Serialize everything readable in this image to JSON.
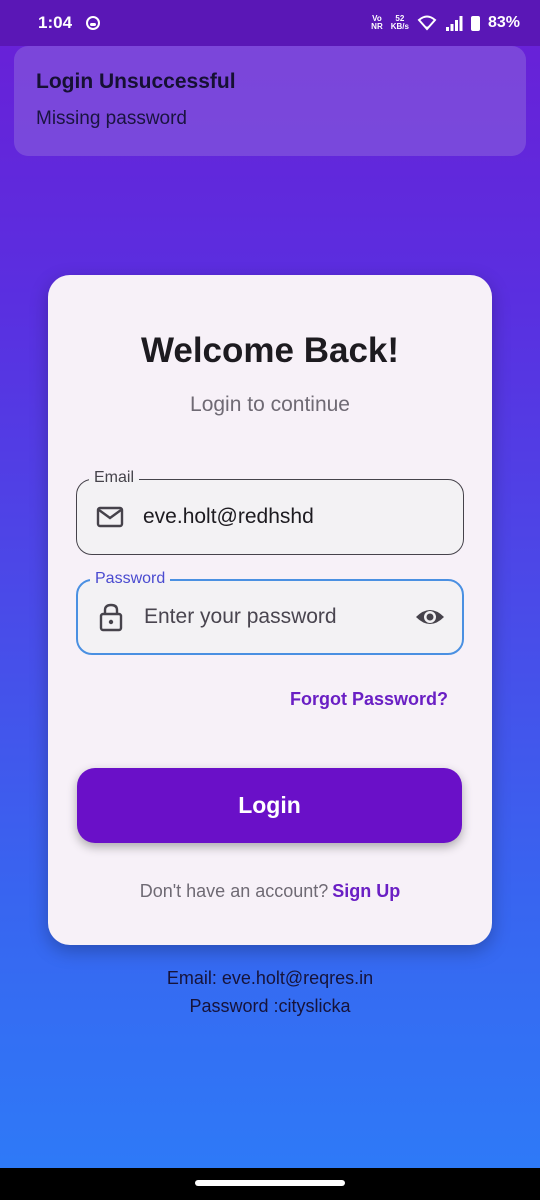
{
  "status_bar": {
    "time": "1:04",
    "net_label_top": "Vo",
    "net_label_bottom": "NR",
    "speed_value": "52",
    "speed_unit": "KB/s",
    "battery": "83%"
  },
  "toast": {
    "title": "Login Unsuccessful",
    "message": "Missing password"
  },
  "card": {
    "title": "Welcome Back!",
    "subtitle": "Login to continue",
    "email": {
      "label": "Email",
      "value": "eve.holt@redhshd",
      "icon": "mail-icon"
    },
    "password": {
      "label": "Password",
      "placeholder": "Enter your password",
      "icon": "lock-icon",
      "toggle_icon": "eye-icon"
    },
    "forgot_label": "Forgot Password?",
    "login_label": "Login",
    "signup_prompt": "Don't have an account?",
    "signup_label": "Sign Up"
  },
  "hint": {
    "email_line": "Email: eve.holt@reqres.in",
    "password_line": "Password :cityslicka"
  },
  "colors": {
    "accent": "#6a10c8",
    "focus": "#4a90e2",
    "gradient_top": "#6a1fd6",
    "gradient_bottom": "#2d7cf8"
  }
}
